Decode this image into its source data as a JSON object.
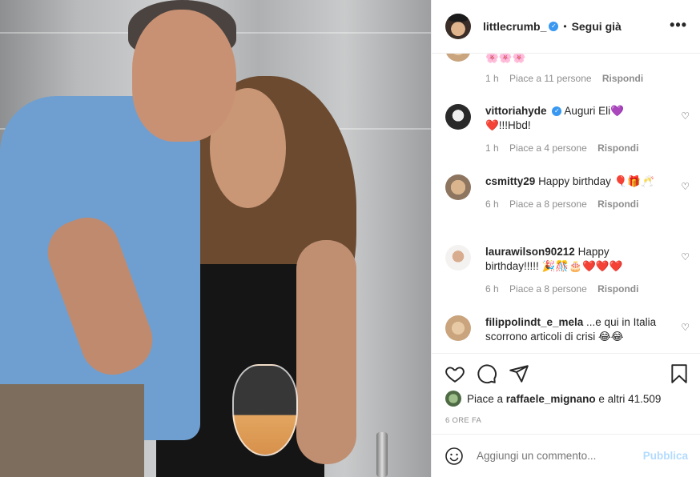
{
  "post": {
    "username": "littlecrumb_",
    "follow_status": "Segui già",
    "more_label": "•••",
    "dot": "•"
  },
  "comments": [
    {
      "username": "",
      "text": "🌸🌸🌸",
      "time": "1 h",
      "likes": "Piace a 11 persone",
      "reply": "Rispondi"
    },
    {
      "username": "vittoriahyde",
      "text": "Auguri Eli💜❤️!!!Hbd!",
      "time": "1 h",
      "likes": "Piace a 4 persone",
      "reply": "Rispondi"
    },
    {
      "username": "csmitty29",
      "text": "Happy birthday 🎈🎁🥂",
      "time": "6 h",
      "likes": "Piace a 8 persone",
      "reply": "Rispondi"
    },
    {
      "username": "laurawilson90212",
      "text": "Happy birthday!!!!! 🎉🎊🎂❤️❤️❤️",
      "time": "6 h",
      "likes": "Piace a 8 persone",
      "reply": "Rispondi"
    },
    {
      "username": "filippolindt_e_mela",
      "text": "...e qui in Italia scorrono articoli di crisi 😂😂",
      "time": "",
      "likes": "",
      "reply": ""
    }
  ],
  "actions": {
    "like_icon": "heart-outline-icon",
    "comment_icon": "comment-bubble-icon",
    "share_icon": "paper-plane-icon",
    "save_icon": "bookmark-icon"
  },
  "likes": {
    "prefix": "Piace a",
    "user": "raffaele_mignano",
    "suffix": "e altri 41.509"
  },
  "timestamp": "6 ORE FA",
  "add_comment": {
    "placeholder": "Aggiungi un commento...",
    "post_label": "Pubblica",
    "emoji_icon": "smiley-icon"
  },
  "colors": {
    "accent": "#3897f0",
    "muted": "#8e8e8e",
    "post_disabled": "#b3dbff"
  }
}
